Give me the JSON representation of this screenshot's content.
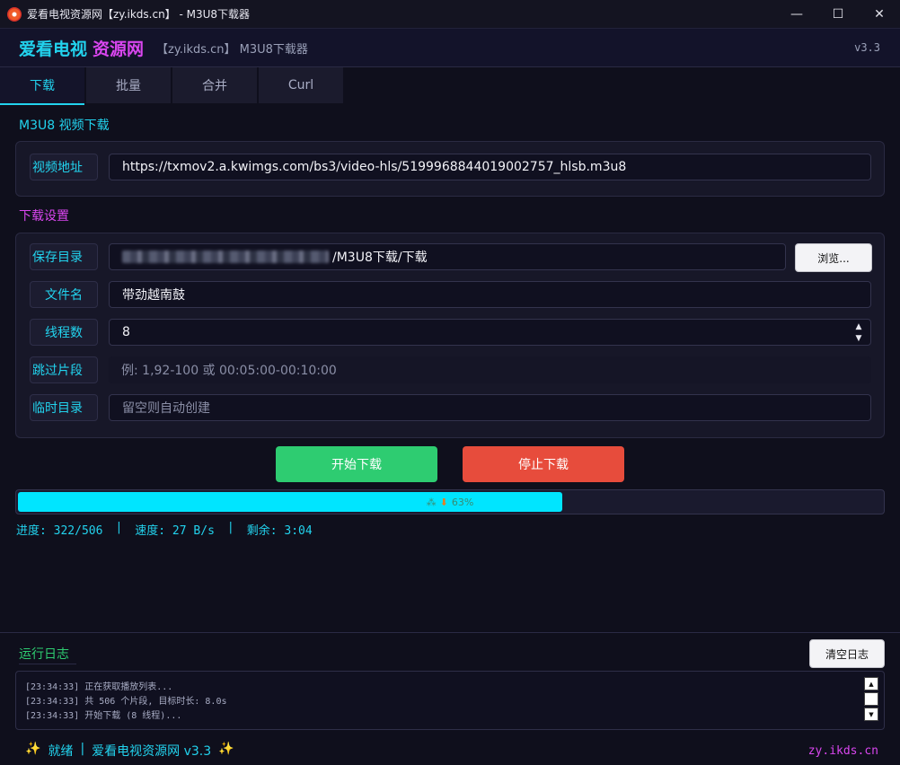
{
  "window": {
    "title": "爱看电视资源网【zy.ikds.cn】 - M3U8下载器",
    "minimize_glyph": "—",
    "maximize_glyph": "☐",
    "close_glyph": "✕"
  },
  "header": {
    "brand_part1": "爱看电视",
    "brand_part2": "资源网",
    "subtitle": "【zy.ikds.cn】 M3U8下载器",
    "version": "v3.3"
  },
  "tabs": [
    {
      "label": "下载",
      "active": true
    },
    {
      "label": "批量",
      "active": false
    },
    {
      "label": "合并",
      "active": false
    },
    {
      "label": "Curl",
      "active": false
    }
  ],
  "video_section": {
    "title": "M3U8 视频下载",
    "url_label": "视频地址",
    "url_value": "https://txmov2.a.kwimgs.com/bs3/video-hls/5199968844019002757_hlsb.m3u8"
  },
  "settings": {
    "title": "下载设置",
    "save_dir_label": "保存目录",
    "save_dir_value": "/M3U8下载/下载",
    "browse_label": "浏览...",
    "filename_label": "文件名",
    "filename_value": "带劲越南鼓",
    "threads_label": "线程数",
    "threads_value": "8",
    "skip_label": "跳过片段",
    "skip_placeholder": "例: 1,92-100 或 00:05:00-00:10:00",
    "temp_label": "临时目录",
    "temp_placeholder": "留空则自动创建"
  },
  "actions": {
    "start_label": "开始下载",
    "stop_label": "停止下载"
  },
  "progress": {
    "percent": 63,
    "text": "63%",
    "icon_left": "⁂",
    "icon_right": "⬇"
  },
  "stats": {
    "progress": "进度: 322/506",
    "sep1": "|",
    "speed": "速度: 27 B/s",
    "sep2": "|",
    "remaining": "剩余: 3:04"
  },
  "log": {
    "title": "运行日志",
    "clear_label": "清空日志",
    "lines": [
      "[23:34:33] 正在获取播放列表...",
      "[23:34:33] 共 506 个片段, 目标时长: 8.0s",
      "[23:34:33] 开始下载 (8 线程)..."
    ]
  },
  "statusbar": {
    "sparkle": "✨",
    "ready": "就绪",
    "separator": "|",
    "app_name": "爱看电视资源网 v3.3",
    "site": "zy.ikds.cn"
  },
  "colors": {
    "accent_cyan": "#22d3ee",
    "accent_magenta": "#d946ef",
    "start_green": "#2ecc71",
    "stop_red": "#e74c3c",
    "progress_fill": "#00e5ff"
  }
}
